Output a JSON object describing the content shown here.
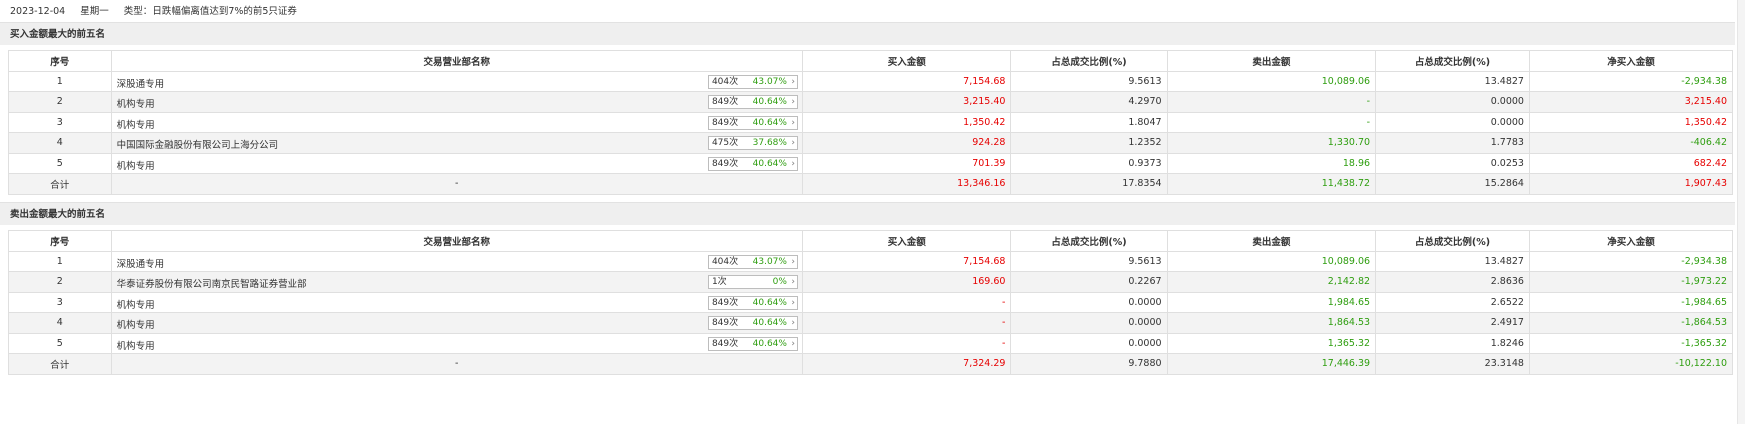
{
  "header": {
    "date": "2023-12-04",
    "weekday": "星期一",
    "type_label": "类型：",
    "type_value": "日跌幅偏离值达到7%的前5只证券"
  },
  "columns": [
    "序号",
    "交易营业部名称",
    "买入金额",
    "占总成交比例(%)",
    "卖出金额",
    "占总成交比例(%)",
    "净买入金额"
  ],
  "colors": {
    "up": "#e60000",
    "down": "#2f9e10"
  },
  "buy_section": {
    "title": "买入金额最大的前五名",
    "rows": [
      {
        "idx": "1",
        "name": "深股通专用",
        "times": "404次",
        "pct": "43.07%",
        "buy": "7,154.68",
        "buy_ratio": "9.5613",
        "sell": "10,089.06",
        "sell_ratio": "13.4827",
        "net": "-2,934.38"
      },
      {
        "idx": "2",
        "name": "机构专用",
        "times": "849次",
        "pct": "40.64%",
        "buy": "3,215.40",
        "buy_ratio": "4.2970",
        "sell": "-",
        "sell_ratio": "0.0000",
        "net": "3,215.40"
      },
      {
        "idx": "3",
        "name": "机构专用",
        "times": "849次",
        "pct": "40.64%",
        "buy": "1,350.42",
        "buy_ratio": "1.8047",
        "sell": "-",
        "sell_ratio": "0.0000",
        "net": "1,350.42"
      },
      {
        "idx": "4",
        "name": "中国国际金融股份有限公司上海分公司",
        "times": "475次",
        "pct": "37.68%",
        "buy": "924.28",
        "buy_ratio": "1.2352",
        "sell": "1,330.70",
        "sell_ratio": "1.7783",
        "net": "-406.42"
      },
      {
        "idx": "5",
        "name": "机构专用",
        "times": "849次",
        "pct": "40.64%",
        "buy": "701.39",
        "buy_ratio": "0.9373",
        "sell": "18.96",
        "sell_ratio": "0.0253",
        "net": "682.42"
      }
    ],
    "total": {
      "label": "合计",
      "name": "-",
      "buy": "13,346.16",
      "buy_ratio": "17.8354",
      "sell": "11,438.72",
      "sell_ratio": "15.2864",
      "net": "1,907.43"
    }
  },
  "sell_section": {
    "title": "卖出金额最大的前五名",
    "rows": [
      {
        "idx": "1",
        "name": "深股通专用",
        "times": "404次",
        "pct": "43.07%",
        "buy": "7,154.68",
        "buy_ratio": "9.5613",
        "sell": "10,089.06",
        "sell_ratio": "13.4827",
        "net": "-2,934.38"
      },
      {
        "idx": "2",
        "name": "华泰证券股份有限公司南京民智路证券营业部",
        "times": "1次",
        "pct": "0%",
        "buy": "169.60",
        "buy_ratio": "0.2267",
        "sell": "2,142.82",
        "sell_ratio": "2.8636",
        "net": "-1,973.22"
      },
      {
        "idx": "3",
        "name": "机构专用",
        "times": "849次",
        "pct": "40.64%",
        "buy": "-",
        "buy_ratio": "0.0000",
        "sell": "1,984.65",
        "sell_ratio": "2.6522",
        "net": "-1,984.65"
      },
      {
        "idx": "4",
        "name": "机构专用",
        "times": "849次",
        "pct": "40.64%",
        "buy": "-",
        "buy_ratio": "0.0000",
        "sell": "1,864.53",
        "sell_ratio": "2.4917",
        "net": "-1,864.53"
      },
      {
        "idx": "5",
        "name": "机构专用",
        "times": "849次",
        "pct": "40.64%",
        "buy": "-",
        "buy_ratio": "0.0000",
        "sell": "1,365.32",
        "sell_ratio": "1.8246",
        "net": "-1,365.32"
      }
    ],
    "total": {
      "label": "合计",
      "name": "-",
      "buy": "7,324.29",
      "buy_ratio": "9.7880",
      "sell": "17,446.39",
      "sell_ratio": "23.3148",
      "net": "-10,122.10"
    }
  }
}
